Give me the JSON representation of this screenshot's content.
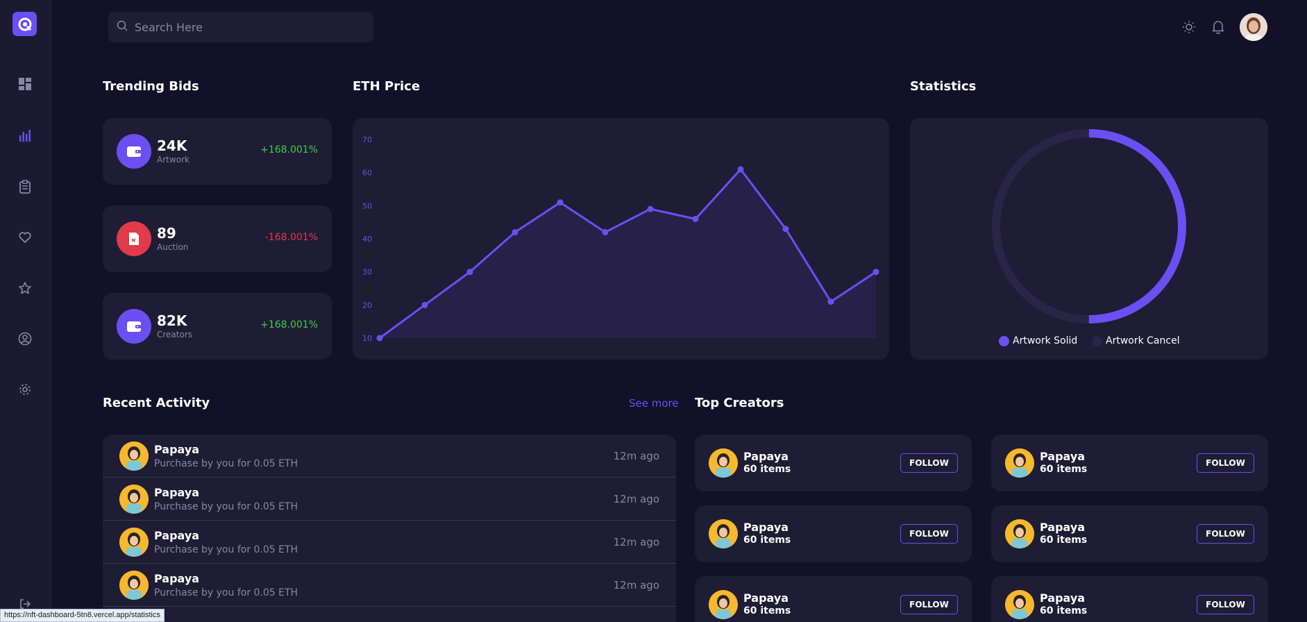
{
  "app": {
    "search_placeholder": "Search Here",
    "accent_color": "#6c4ff2",
    "status_url": "https://nft-dashboard-5tn8.vercel.app/statistics"
  },
  "sidebar": {
    "icons": [
      "dashboard-icon",
      "bar-chart-icon",
      "clipboard-icon",
      "heart-icon",
      "star-icon",
      "user-icon",
      "gear-icon",
      "logout-icon"
    ],
    "active": "bar-chart-icon"
  },
  "trending": {
    "title": "Trending Bids",
    "cards": [
      {
        "value": "24K",
        "label": "Artwork",
        "change": "+168.001%",
        "color": "#6c4ff2",
        "change_color": "#3ecf4a",
        "icon": "wallet-icon"
      },
      {
        "value": "89",
        "label": "Auction",
        "change": "-168.001%",
        "color": "#e23a4b",
        "change_color": "#e23a4b",
        "icon": "document-icon"
      },
      {
        "value": "82K",
        "label": "Creators",
        "change": "+168.001%",
        "color": "#6c4ff2",
        "change_color": "#3ecf4a",
        "icon": "wallet-icon"
      }
    ]
  },
  "eth": {
    "title": "ETH Price",
    "chart_data": {
      "type": "area",
      "x": [
        1,
        2,
        3,
        4,
        5,
        6,
        7,
        8,
        9,
        10,
        11,
        12
      ],
      "series": [
        {
          "values": [
            10,
            20,
            30,
            42,
            51,
            42,
            49,
            46,
            61,
            43,
            21,
            30
          ]
        }
      ],
      "yticks": [
        "10",
        "20",
        "30",
        "40",
        "50",
        "60",
        "70"
      ],
      "ylim": [
        10,
        70
      ],
      "grid": false,
      "color": "#6c4ff2"
    }
  },
  "statistics": {
    "title": "Statistics",
    "chart_data": {
      "type": "pie",
      "style": "donut",
      "labels": [
        "Artwork Solid",
        "Artwork Cancel"
      ],
      "values": [
        50,
        50
      ],
      "colors": [
        "#6c4ff2",
        "#2a2546"
      ]
    },
    "legend": [
      "Artwork Solid",
      "Artwork Cancel"
    ]
  },
  "activity": {
    "title": "Recent Activity",
    "see_more": "See more",
    "rows": [
      {
        "name": "Papaya",
        "desc": "Purchase by you for 0.05 ETH",
        "time": "12m ago"
      },
      {
        "name": "Papaya",
        "desc": "Purchase by you for 0.05 ETH",
        "time": "12m ago"
      },
      {
        "name": "Papaya",
        "desc": "Purchase by you for 0.05 ETH",
        "time": "12m ago"
      },
      {
        "name": "Papaya",
        "desc": "Purchase by you for 0.05 ETH",
        "time": "12m ago"
      }
    ]
  },
  "creators": {
    "title": "Top Creators",
    "follow_label": "FOLLOW",
    "items": [
      {
        "name": "Papaya",
        "items": "60 items"
      },
      {
        "name": "Papaya",
        "items": "60 items"
      },
      {
        "name": "Papaya",
        "items": "60 items"
      },
      {
        "name": "Papaya",
        "items": "60 items"
      },
      {
        "name": "Papaya",
        "items": "60 items"
      },
      {
        "name": "Papaya",
        "items": "60 items"
      }
    ]
  }
}
